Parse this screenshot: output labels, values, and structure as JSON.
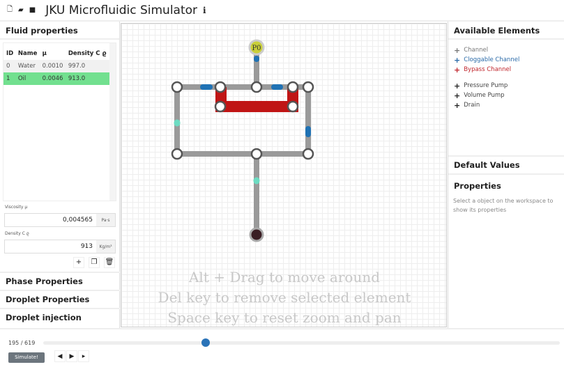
{
  "app": {
    "title": "JKU Microfluidic Simulator",
    "icons": [
      "new-file-icon",
      "open-folder-icon",
      "save-icon",
      "info-icon"
    ]
  },
  "left": {
    "fluid_header": "Fluid properties",
    "columns": [
      "ID",
      "Name",
      "μ",
      "Density C ϱ"
    ],
    "rows": [
      [
        "0",
        "Water",
        "0.0010",
        "997.0"
      ],
      [
        "1",
        "Oil",
        "0.0046",
        "913.0"
      ]
    ],
    "selected_row": 1,
    "viscosity_label": "Viscosity μ",
    "viscosity_value": "0,004565",
    "viscosity_unit": "Pa·s",
    "density_label": "Density C ϱ",
    "density_value": "913",
    "density_unit": "Kg/m³",
    "sections": [
      "Phase Properties",
      "Droplet Properties",
      "Droplet injection"
    ]
  },
  "canvas": {
    "pump_label": "P0",
    "hints": [
      "Alt + Drag to move around",
      "Del key to remove selected element",
      "Space key to reset zoom and pan"
    ],
    "colors": {
      "channel": "#9a9a9a",
      "bypass": "#c01515",
      "droplet_blue": "#1f72b4",
      "droplet_teal": "#6ddcc2",
      "pump": "#c9cf3a",
      "drain": "#3a1e24"
    }
  },
  "right": {
    "available_header": "Available Elements",
    "elements": [
      {
        "label": "Channel",
        "color": "#777777"
      },
      {
        "label": "Cloggable Channel",
        "color": "#2a6aa8"
      },
      {
        "label": "Bypass Channel",
        "color": "#c0262d"
      },
      {
        "label": "Pressure Pump",
        "color": "#333333"
      },
      {
        "label": "Volume Pump",
        "color": "#333333"
      },
      {
        "label": "Drain",
        "color": "#333333"
      }
    ],
    "default_header": "Default Values",
    "properties_header": "Properties",
    "properties_hint": "Select a object on the workspace to show its properties"
  },
  "bottom": {
    "step": "195 / 619",
    "current": 195,
    "total": 619,
    "simulate": "Simulate!"
  }
}
